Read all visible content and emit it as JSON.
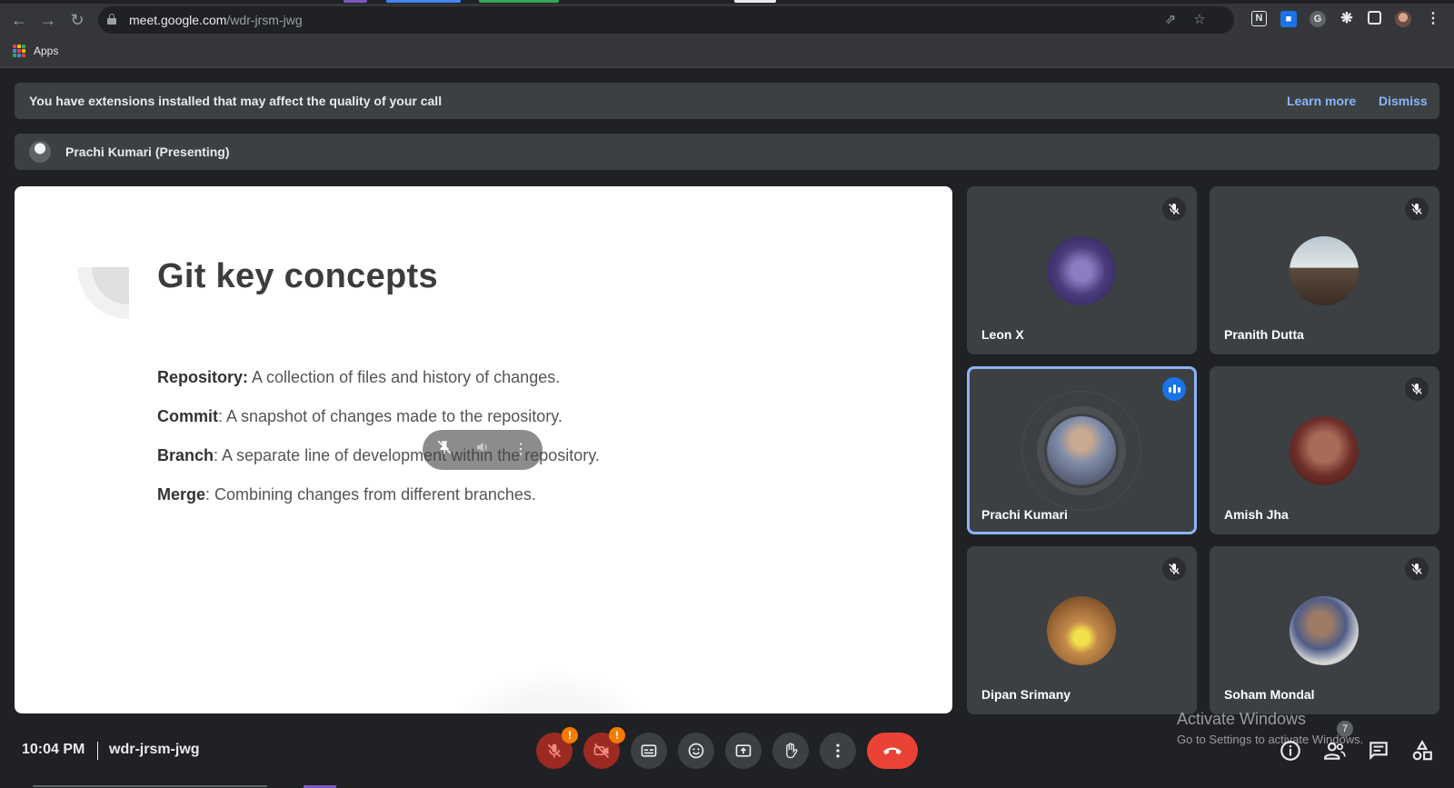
{
  "browser": {
    "url_host": "meet.google.com",
    "url_path": "/wdr-jrsm-jwg",
    "bookmark_apps": "Apps"
  },
  "banner": {
    "message": "You have extensions installed that may affect the quality of your call",
    "learn_more": "Learn more",
    "dismiss": "Dismiss"
  },
  "presenting": {
    "label": "Prachi Kumari (Presenting)"
  },
  "slide": {
    "title": "Git key concepts",
    "bullets": [
      {
        "term": "Repository:",
        "text": " A collection of files and history of changes."
      },
      {
        "term": "Commit",
        "text": ": A snapshot of changes made to the repository."
      },
      {
        "term": "Branch",
        "text": ": A separate line of development within the repository."
      },
      {
        "term": "Merge",
        "text": ": Combining changes from different branches."
      }
    ]
  },
  "participants": [
    {
      "name": "Leon X",
      "muted": true,
      "speaking": false
    },
    {
      "name": "Pranith Dutta",
      "muted": true,
      "speaking": false
    },
    {
      "name": "Prachi Kumari",
      "muted": false,
      "speaking": true
    },
    {
      "name": "Amish Jha",
      "muted": true,
      "speaking": false
    },
    {
      "name": "Dipan Srimany",
      "muted": true,
      "speaking": false
    },
    {
      "name": "Soham Mondal",
      "muted": true,
      "speaking": false
    }
  ],
  "footer": {
    "time": "10:04 PM",
    "meeting_code": "wdr-jrsm-jwg",
    "people_count": "7",
    "mic_warning": "!",
    "camera_warning": "!"
  },
  "watermark": {
    "title": "Activate Windows",
    "subtitle": "Go to Settings to activate Windows."
  },
  "colors": {
    "accent": "#8ab4f8",
    "speaking": "#1a73e8",
    "end_call": "#ea4335",
    "warning": "#f57c00",
    "tile_bg": "#3c4043",
    "page_bg": "#202124"
  }
}
